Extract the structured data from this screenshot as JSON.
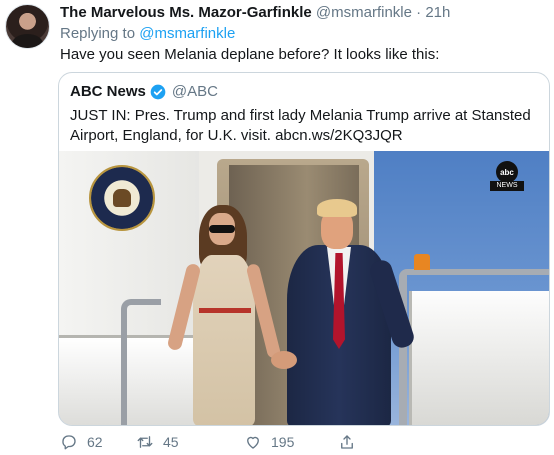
{
  "author": {
    "display_name": "The Marvelous Ms. Mazor-Garfinkle",
    "handle": "@msmarfinkle",
    "separator": "·",
    "time": "21h"
  },
  "reply": {
    "prefix": "Replying to",
    "mention": "@msmarfinkle"
  },
  "tweet_text": "Have you seen Melania deplane before? It looks like this:",
  "quote": {
    "name": "ABC News",
    "handle": "@ABC",
    "text": "JUST IN: Pres. Trump and first lady Melania Trump arrive at Stansted Airport, England, for U.K. visit. abcn.ws/2KQ3JQR",
    "media_watermark_logo": "abc",
    "media_watermark_label": "NEWS"
  },
  "actions": {
    "reply_count": "62",
    "retweet_count": "45",
    "like_count": "195"
  },
  "colors": {
    "text": "#14171a",
    "secondary": "#657786",
    "link": "#1da1f2",
    "border": "#ccd6dd"
  },
  "icons": {
    "reply": "reply-icon",
    "retweet": "retweet-icon",
    "like": "heart-icon",
    "share": "share-icon",
    "verified": "verified-badge-icon"
  }
}
